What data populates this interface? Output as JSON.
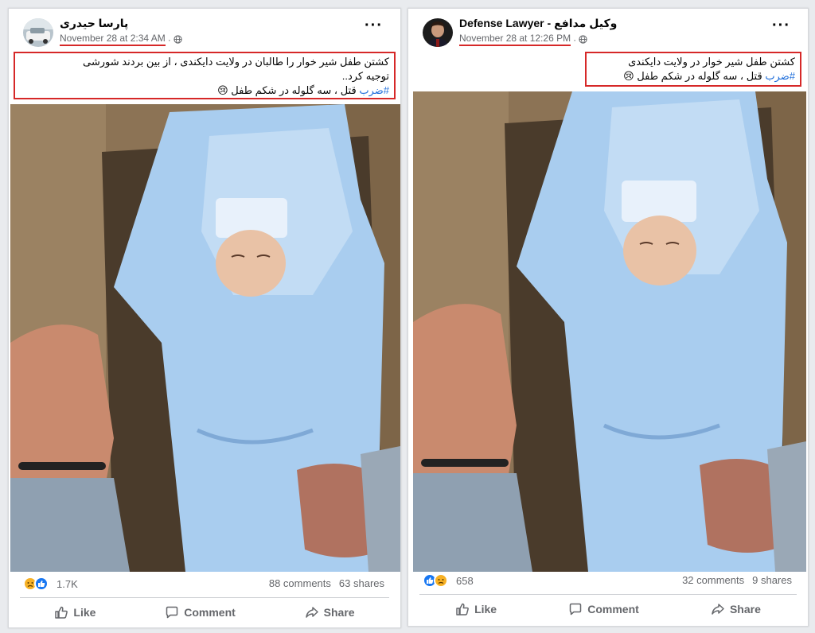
{
  "posts": [
    {
      "author": "پارسا حیدری",
      "timestamp": "November 28 at 2:34 AM",
      "caption_lines": [
        "کشتن طفل شیر خوار را طالبان در ولایت دایکندی ، از بین بردند شورشی",
        "توجیه کرد.."
      ],
      "hashtag": "#ضرب",
      "caption_tail": " قتل ، سه گلوله در شکم طفل 😢",
      "reaction_icons": [
        "sad-react-icon",
        "like-react-icon"
      ],
      "reaction_count": "1.7K",
      "comments": "88 comments",
      "shares": "63 shares",
      "actions": {
        "like": "Like",
        "comment": "Comment",
        "share": "Share"
      }
    },
    {
      "author": "Defense Lawyer - وکیل مدافع",
      "timestamp": "November 28 at 12:26 PM",
      "caption_lines": [
        "کشتن طفل شیر خوار در ولایت دایکندی"
      ],
      "hashtag": "#ضرب",
      "caption_tail": " قتل ، سه گلوله در شکم طفل 😢",
      "reaction_icons": [
        "like-react-icon",
        "sad-react-icon"
      ],
      "reaction_count": "658",
      "comments": "32 comments",
      "shares": "9 shares",
      "actions": {
        "like": "Like",
        "comment": "Comment",
        "share": "Share"
      }
    }
  ],
  "colors": {
    "highlight_red": "#d62828",
    "hashtag_blue": "#216fdb",
    "muted_text": "#65676b",
    "shroud_blue": "#a9cdef"
  }
}
